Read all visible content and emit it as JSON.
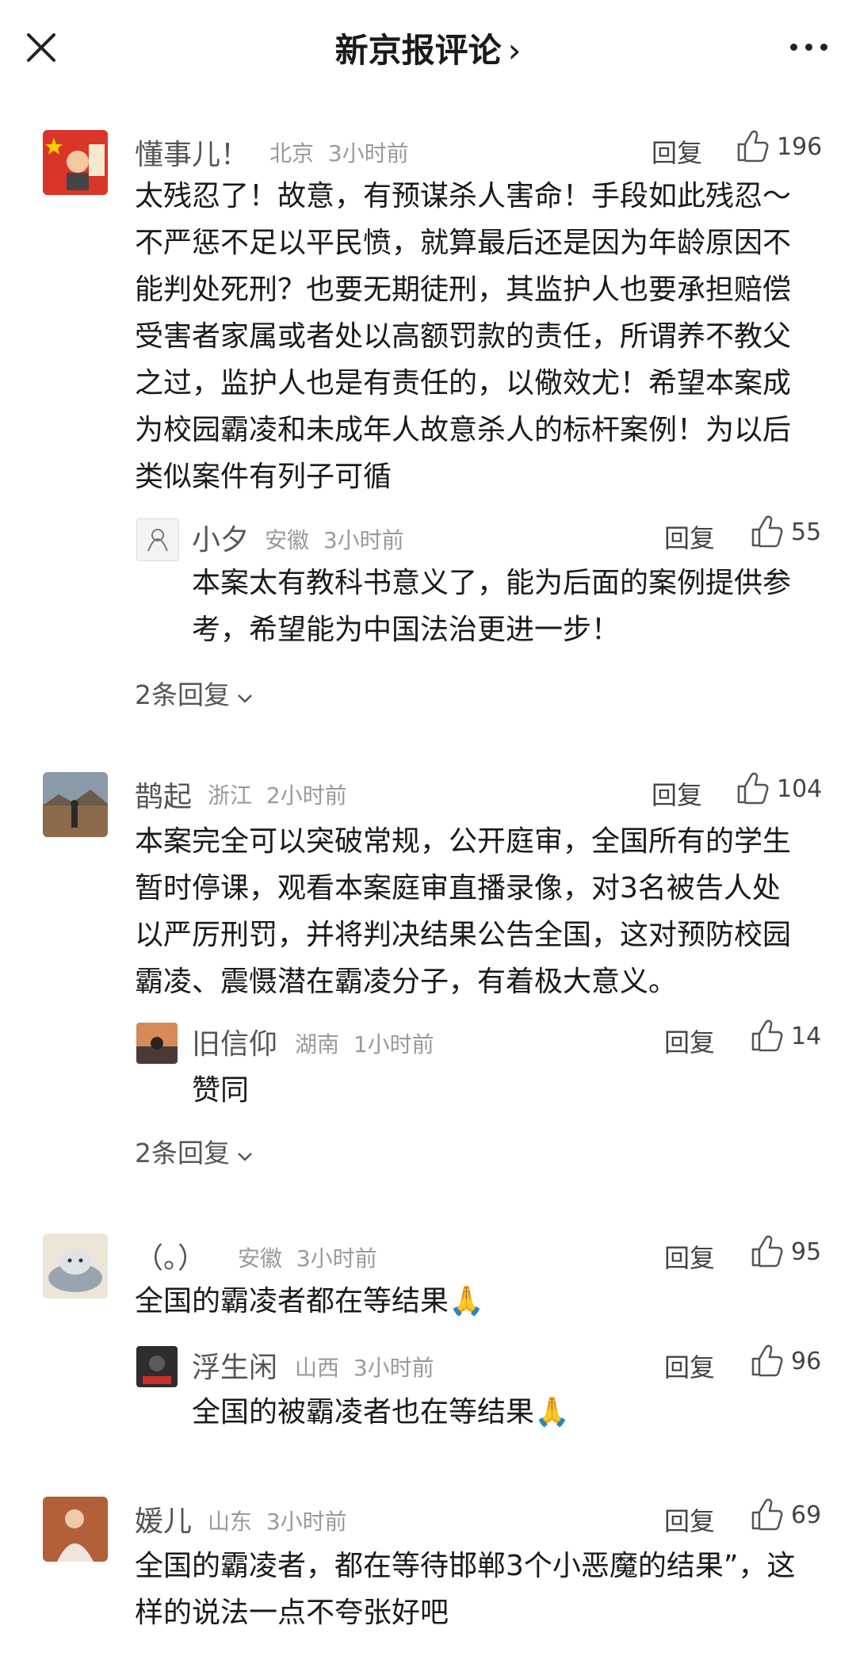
{
  "header": {
    "title": "新京报评论",
    "title_chevron": "›"
  },
  "comments": [
    {
      "user": "懂事儿！",
      "location": "北京",
      "time": "3小时前",
      "reply_label": "回复",
      "likes": "196",
      "text": "太残忍了！故意，有预谋杀人害命！手段如此残忍～不严惩不足以平民愤，就算最后还是因为年龄原因不能判处死刑？也要无期徒刑，其监护人也要承担赔偿受害者家属或者处以高额罚款的责任，所谓养不教父之过，监护人也是有责任的，以儆效尤！希望本案成为校园霸凌和未成年人故意杀人的标杆案例！为以后类似案件有列子可循",
      "reply": {
        "user": "小夕",
        "location": "安徽",
        "time": "3小时前",
        "reply_label": "回复",
        "likes": "55",
        "text": "本案太有教科书意义了，能为后面的案例提供参考，希望能为中国法治更进一步！"
      },
      "more_replies": "2条回复"
    },
    {
      "user": "鹊起",
      "location": "浙江",
      "time": "2小时前",
      "reply_label": "回复",
      "likes": "104",
      "text": "本案完全可以突破常规，公开庭审，全国所有的学生暂时停课，观看本案庭审直播录像，对3名被告人处以严厉刑罚，并将判决结果公告全国，这对预防校园霸凌、震慑潜在霸凌分子，有着极大意义。",
      "reply": {
        "user": "旧信仰",
        "location": "湖南",
        "time": "1小时前",
        "reply_label": "回复",
        "likes": "14",
        "text": "赞同"
      },
      "more_replies": "2条回复"
    },
    {
      "user": "（。）",
      "location": "安徽",
      "time": "3小时前",
      "reply_label": "回复",
      "likes": "95",
      "text": "全国的霸凌者都在等结果🙏",
      "reply": {
        "user": "浮生闲",
        "location": "山西",
        "time": "3小时前",
        "reply_label": "回复",
        "likes": "96",
        "text": "全国的被霸凌者也在等结果🙏"
      }
    },
    {
      "user": "媛儿",
      "location": "山东",
      "time": "3小时前",
      "reply_label": "回复",
      "likes": "69",
      "text": "全国的霸凌者，都在等待邯郸3个小恶魔的结果”，这样的说法一点不夸张好吧"
    }
  ],
  "icons": {
    "close": "close-icon",
    "more": "more-icon",
    "like": "thumbs-up-icon",
    "expand": "chevron-down-icon"
  }
}
